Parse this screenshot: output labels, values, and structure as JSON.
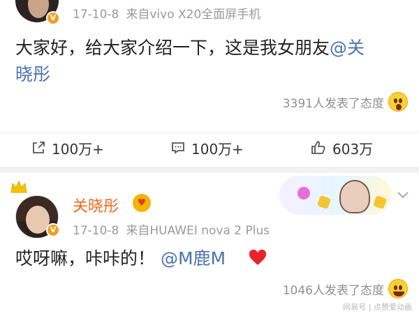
{
  "post1": {
    "meta_date": "17-10-8",
    "meta_source": "来自vivo X20全面屏手机",
    "text_main": "大家好，给大家介绍一下，这是我女朋友",
    "text_mention_part1": "@关",
    "text_mention_part2": "晓彤",
    "reactions": "3391人发表了态度",
    "actions": {
      "share_count": "100万+",
      "comment_count": "100万+",
      "like_count": "603万"
    }
  },
  "post2": {
    "username": "关晓彤",
    "meta_date": "17-10-8",
    "meta_source": "来自HUAWEI nova 2 Plus",
    "text_main": "哎呀嘛，咔咔的！",
    "text_mention": "@M鹿M",
    "reactions": "1046人发表了态度"
  },
  "watermark": "网易号 | 点赞爱动画",
  "icons": {
    "share": "share-icon",
    "comment": "comment-icon",
    "like": "thumbs-up-icon",
    "heart": "heart-icon",
    "more": "chevron-down-icon"
  },
  "colors": {
    "username": "#f06a1a",
    "mention": "#4a73b0",
    "meta": "#9a9a9a",
    "heart": "#e8232d"
  }
}
